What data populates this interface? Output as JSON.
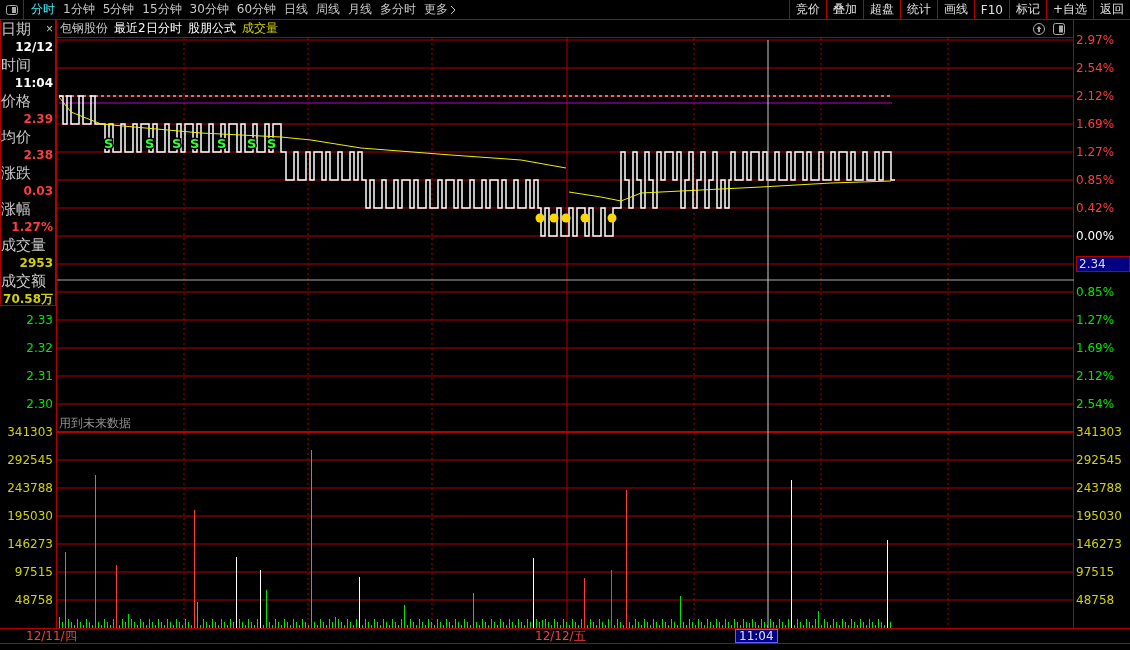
{
  "toolbar": {
    "tabs": [
      {
        "label": "分时",
        "selected": true
      },
      {
        "label": "1分钟",
        "selected": false
      },
      {
        "label": "5分钟",
        "selected": false
      },
      {
        "label": "15分钟",
        "selected": false
      },
      {
        "label": "30分钟",
        "selected": false
      },
      {
        "label": "60分钟",
        "selected": false
      },
      {
        "label": "日线",
        "selected": false
      },
      {
        "label": "周线",
        "selected": false
      },
      {
        "label": "月线",
        "selected": false
      },
      {
        "label": "多分时",
        "selected": false
      },
      {
        "label": "更多",
        "selected": false
      }
    ],
    "buttons": [
      "竞价",
      "叠加",
      "超盘",
      "统计",
      "画线",
      "F10",
      "标记",
      "+自选",
      "返回"
    ]
  },
  "info_panel": {
    "close": "×",
    "rows": [
      {
        "label": "日期",
        "value": "12/12",
        "kind": "time"
      },
      {
        "label": "时间",
        "value": "11:04",
        "kind": "time"
      },
      {
        "label": "价格",
        "value": "2.39",
        "kind": "price"
      },
      {
        "label": "均价",
        "value": "2.38",
        "kind": "price"
      },
      {
        "label": "涨跌",
        "value": "0.03",
        "kind": "price"
      },
      {
        "label": "涨幅",
        "value": "1.27%",
        "kind": "price"
      },
      {
        "label": "成交量",
        "value": "2953",
        "kind": "volume"
      },
      {
        "label": "成交额",
        "value": "70.58万",
        "kind": "volume"
      }
    ]
  },
  "chart_header": [
    {
      "text": "包钢股份",
      "kind": "name"
    },
    {
      "text": "最近2日分时",
      "kind": "plain"
    },
    {
      "text": "股朋公式",
      "kind": "plain"
    },
    {
      "text": "成交量",
      "kind": "indicator"
    }
  ],
  "signal_marks": [
    {
      "label": "S"
    },
    {
      "label": "S"
    },
    {
      "label": "S"
    },
    {
      "label": "S"
    },
    {
      "label": "S"
    },
    {
      "label": "S"
    },
    {
      "label": "S"
    }
  ],
  "notice": "用到未来数据",
  "left_axis": [
    {
      "text": "2.33",
      "kind": "down"
    },
    {
      "text": "2.32",
      "kind": "down"
    },
    {
      "text": "2.31",
      "kind": "down"
    },
    {
      "text": "2.30",
      "kind": "down"
    },
    {
      "text": "341303",
      "kind": "volume"
    },
    {
      "text": "292545",
      "kind": "volume"
    },
    {
      "text": "243788",
      "kind": "volume"
    },
    {
      "text": "195030",
      "kind": "volume"
    },
    {
      "text": "146273",
      "kind": "volume"
    },
    {
      "text": "97515",
      "kind": "volume"
    },
    {
      "text": "48758",
      "kind": "volume"
    }
  ],
  "right_axis": [
    {
      "text": "2.97%",
      "kind": "up"
    },
    {
      "text": "2.54%",
      "kind": "up"
    },
    {
      "text": "2.12%",
      "kind": "up"
    },
    {
      "text": "1.69%",
      "kind": "up"
    },
    {
      "text": "1.27%",
      "kind": "up"
    },
    {
      "text": "0.85%",
      "kind": "up"
    },
    {
      "text": "0.42%",
      "kind": "up"
    },
    {
      "text": "0.00%",
      "kind": "flat"
    },
    {
      "text": "2.34",
      "kind": "cursor"
    },
    {
      "text": "0.85%",
      "kind": "down"
    },
    {
      "text": "1.27%",
      "kind": "down"
    },
    {
      "text": "1.69%",
      "kind": "down"
    },
    {
      "text": "2.12%",
      "kind": "down"
    },
    {
      "text": "2.54%",
      "kind": "down"
    },
    {
      "text": "341303",
      "kind": "volume"
    },
    {
      "text": "292545",
      "kind": "volume"
    },
    {
      "text": "243788",
      "kind": "volume"
    },
    {
      "text": "195030",
      "kind": "volume"
    },
    {
      "text": "146273",
      "kind": "volume"
    },
    {
      "text": "97515",
      "kind": "volume"
    },
    {
      "text": "48758",
      "kind": "volume"
    }
  ],
  "time_axis": [
    {
      "text": "12/11/四",
      "kind": "date"
    },
    {
      "text": "12/12/五",
      "kind": "date"
    },
    {
      "text": "11:04",
      "kind": "cursor"
    }
  ]
}
